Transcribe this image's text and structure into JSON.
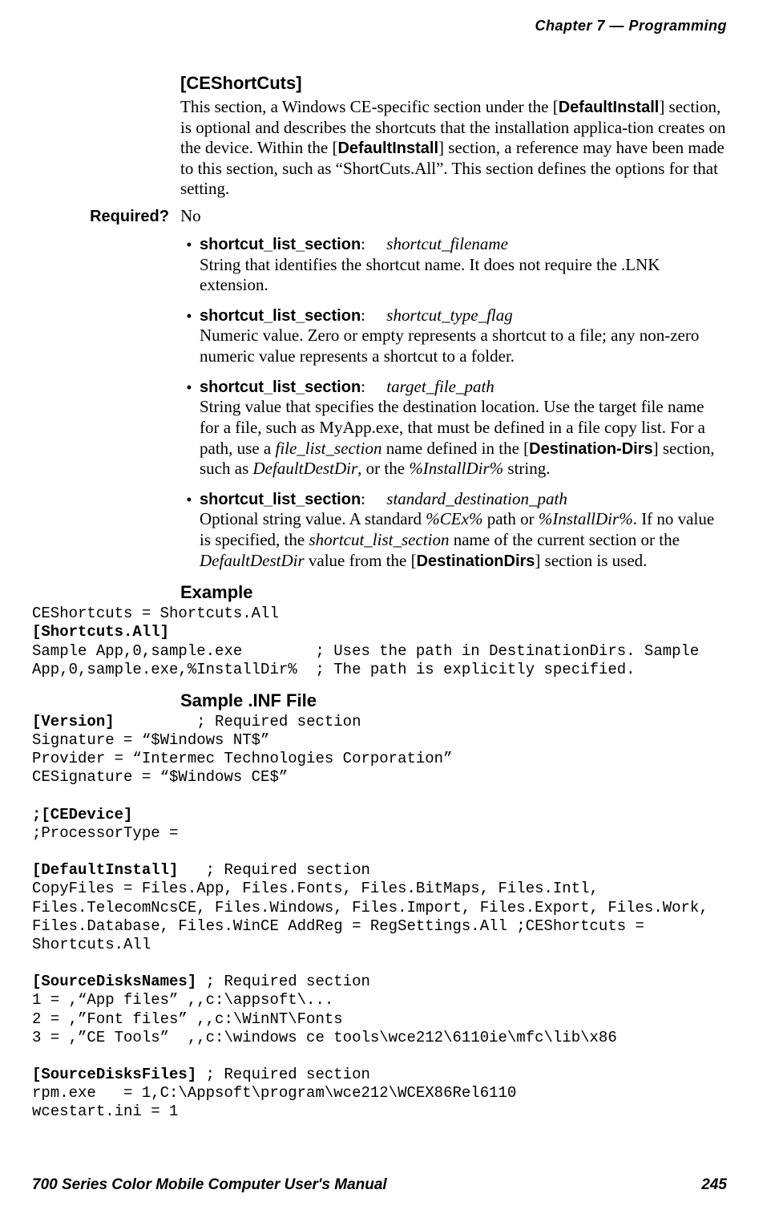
{
  "header": {
    "chapter_line": "Chapter 7 — Programming"
  },
  "section": {
    "title": "[CEShortCuts]",
    "intro_before_di1": "This section, a Windows CE-specific section under the [",
    "di1": "DefaultInstall",
    "intro_mid": "] section, is optional and describes the shortcuts that the installation applica-tion creates on the device. Within the [",
    "di2": "DefaultInstall",
    "intro_after": "] section, a reference may have been made to this section, such as “ShortCuts.All”. This section defines the options for that setting."
  },
  "required": {
    "label": "Required?",
    "value": "No"
  },
  "bullets": [
    {
      "term": "shortcut_list_section",
      "ital": "shortcut_filename",
      "desc": "String that identifies the shortcut name. It does not require the .LNK extension."
    },
    {
      "term": "shortcut_list_section",
      "ital": "shortcut_type_flag",
      "desc": "Numeric value. Zero or empty represents a shortcut to a file; any non-zero numeric value represents a shortcut to a folder."
    },
    {
      "term": "shortcut_list_section",
      "ital": "target_file_path",
      "desc_a": "String value that specifies the destination location. Use the target file name for a file, such as MyApp.exe, that must be defined in a file copy list. For a path, use a ",
      "desc_i1": "file_list_section",
      "desc_b": " name defined in the [",
      "desc_bold": "Destination-Dirs",
      "desc_c": "] section, such as ",
      "desc_i2": "DefaultDestDir",
      "desc_d": ", or the ",
      "desc_i3": "%InstallDir%",
      "desc_e": " string."
    },
    {
      "term": "shortcut_list_section",
      "ital": "standard_destination_path",
      "d4a": "Optional string value. A standard ",
      "d4i1": "%CEx%",
      "d4b": " path or ",
      "d4i2": "%InstallDir%",
      "d4c": ". If no value is specified, the ",
      "d4i3": "shortcut_list_section",
      "d4d": " name of the current section or the ",
      "d4i4": "DefaultDestDir",
      "d4e": " value from the [",
      "d4bold": "DestinationDirs",
      "d4f": "] section is used."
    }
  ],
  "example": {
    "heading": "Example",
    "line1": "CEShortcuts = Shortcuts.All",
    "line2": "[Shortcuts.All]",
    "line3": "Sample App,0,sample.exe        ; Uses the path in DestinationDirs. Sample",
    "line4": "App,0,sample.exe,%InstallDir%  ; The path is explicitly specified."
  },
  "sample": {
    "heading": "Sample .INF File",
    "b1": "[Version]",
    "l1": "         ; Required section",
    "l2": "Signature = “$Windows NT$”",
    "l3": "Provider = “Intermec Technologies Corporation”",
    "l4": "CESignature = “$Windows CE$”",
    "blank1": "",
    "b2": ";[CEDevice]",
    "l5": ";ProcessorType =",
    "blank2": "",
    "b3": "[DefaultInstall]",
    "l6": "   ; Required section",
    "l7": "CopyFiles = Files.App, Files.Fonts, Files.BitMaps, Files.Intl,",
    "l8": "Files.TelecomNcsCE, Files.Windows, Files.Import, Files.Export, Files.Work,",
    "l9": "Files.Database, Files.WinCE AddReg = RegSettings.All ;CEShortcuts =",
    "l10": "Shortcuts.All",
    "blank3": "",
    "b4": "[SourceDisksNames] ",
    "l11": "; Required section",
    "l12": "1 = ,“App files” ,,c:\\appsoft\\...",
    "l13": "2 = ,”Font files” ,,c:\\WinNT\\Fonts",
    "l14": "3 = ,”CE Tools”  ,,c:\\windows ce tools\\wce212\\6110ie\\mfc\\lib\\x86",
    "blank4": "",
    "b5": "[SourceDisksFiles] ",
    "l15": "; Required section",
    "l16": "rpm.exe   = 1,C:\\Appsoft\\program\\wce212\\WCEX86Rel6110",
    "l17": "wcestart.ini = 1"
  },
  "footer": {
    "left": "700 Series Color Mobile Computer User's Manual",
    "right": "245"
  }
}
